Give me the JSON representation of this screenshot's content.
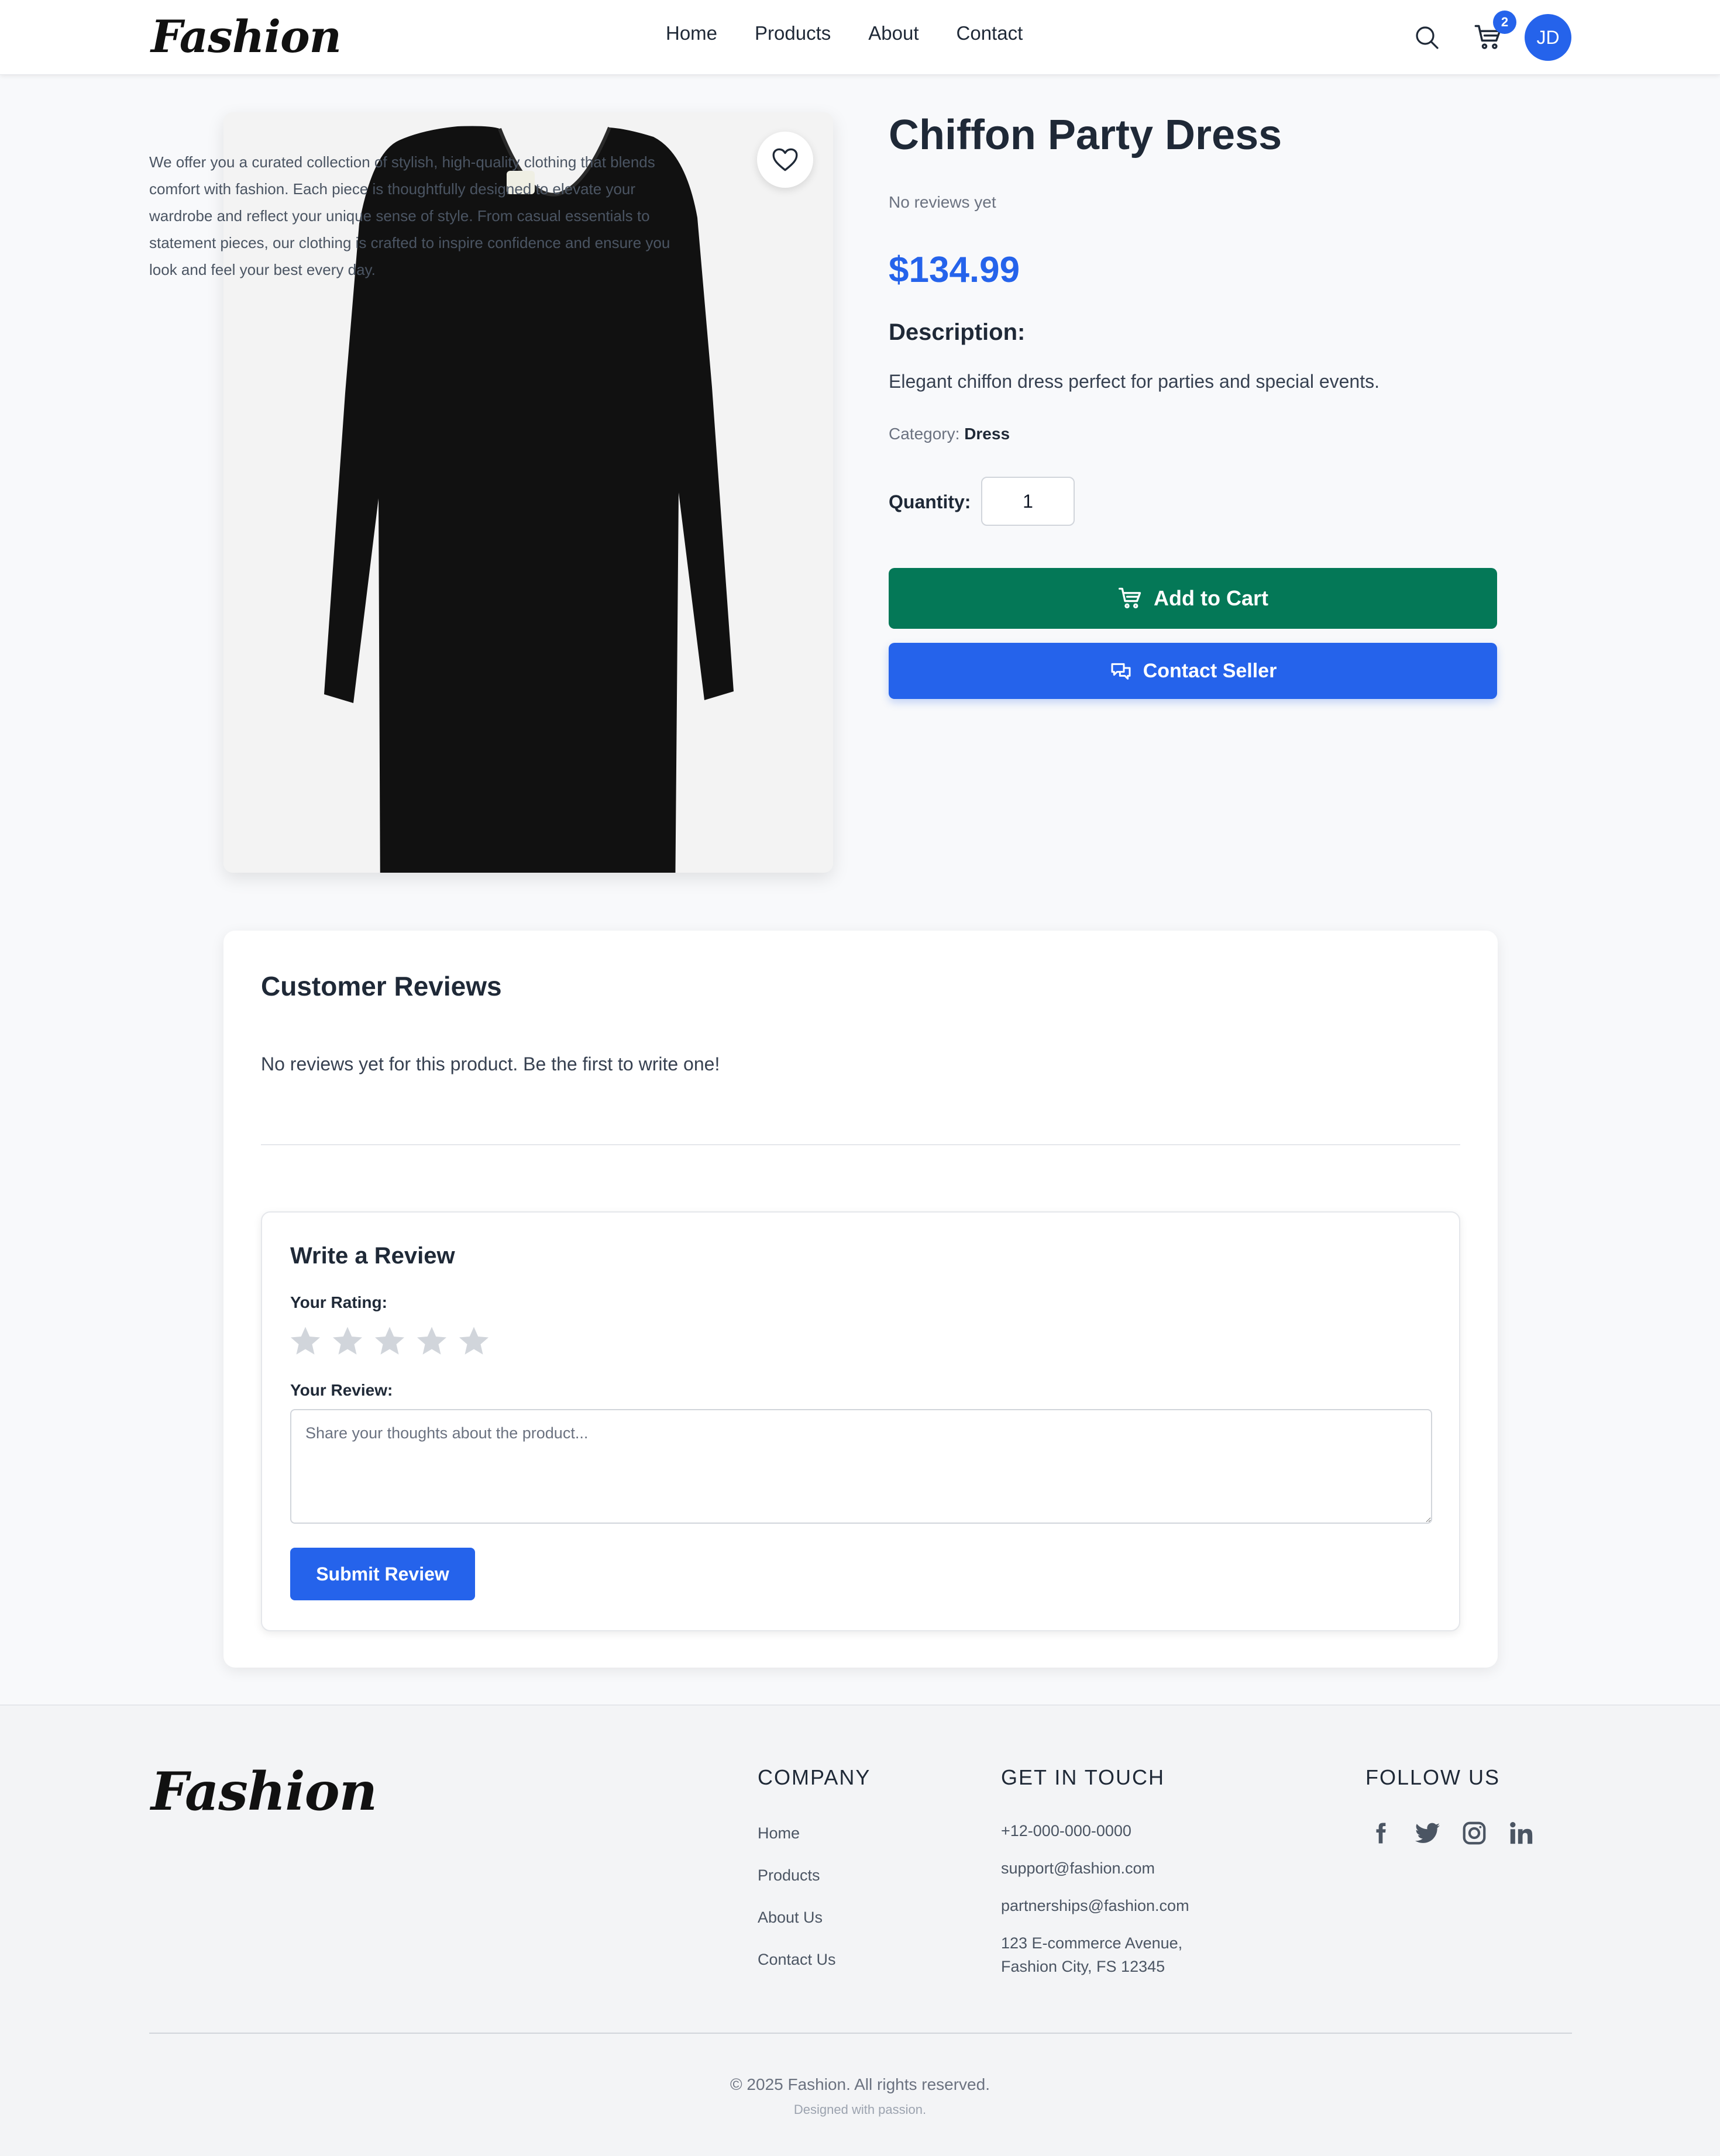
{
  "brand": {
    "logo_text": "Fashion"
  },
  "nav": {
    "items": [
      "Home",
      "Products",
      "About",
      "Contact"
    ]
  },
  "header": {
    "cart_count": "2",
    "avatar_initials": "JD"
  },
  "product": {
    "title": "Chiffon Party Dress",
    "reviews_summary": "No reviews yet",
    "price": "$134.99",
    "description_heading": "Description:",
    "description": "Elegant chiffon dress perfect for parties and special events.",
    "category_label": "Category:",
    "category_value": "Dress",
    "quantity_label": "Quantity:",
    "quantity_value": "1",
    "add_to_cart_label": "Add to Cart",
    "contact_seller_label": "Contact Seller"
  },
  "reviews": {
    "title": "Customer Reviews",
    "empty_message": "No reviews yet for this product. Be the first to write one!",
    "write_title": "Write a Review",
    "rating_label": "Your Rating:",
    "rating_value": 0,
    "rating_max": 5,
    "review_label": "Your Review:",
    "review_placeholder": "Share your thoughts about the product...",
    "submit_label": "Submit Review"
  },
  "footer": {
    "about_text": "We offer you a curated collection of stylish, high-quality clothing that blends comfort with fashion. Each piece is thoughtfully designed to elevate your wardrobe and reflect your unique sense of style. From casual essentials to statement pieces, our clothing is crafted to inspire confidence and ensure you look and feel your best every day.",
    "company_heading": "COMPANY",
    "company_links": [
      "Home",
      "Products",
      "About Us",
      "Contact Us"
    ],
    "contact_heading": "GET IN TOUCH",
    "phone": "+12-000-000-0000",
    "support_email": "support@fashion.com",
    "partnerships_email": "partnerships@fashion.com",
    "address_line1": "123 E-commerce Avenue,",
    "address_line2": "Fashion City, FS 12345",
    "follow_heading": "FOLLOW US",
    "copyright": "© 2025 Fashion. All rights reserved.",
    "tagline": "Designed with passion."
  },
  "colors": {
    "primary": "#2563eb",
    "cart_button": "#047857",
    "star_empty": "#d1d5db",
    "text_dark": "#1f2937"
  },
  "icons": {
    "search": "search-icon",
    "cart": "cart-icon",
    "heart": "heart-icon",
    "chat": "chat-icon",
    "star": "star-icon",
    "facebook": "facebook-icon",
    "twitter": "twitter-icon",
    "instagram": "instagram-icon",
    "linkedin": "linkedin-icon"
  }
}
